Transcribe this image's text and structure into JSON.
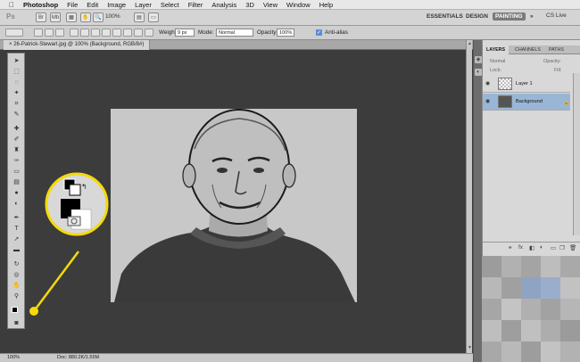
{
  "menubar": {
    "app": "Photoshop",
    "items": [
      "File",
      "Edit",
      "Image",
      "Layer",
      "Select",
      "Filter",
      "Analysis",
      "3D",
      "View",
      "Window",
      "Help"
    ]
  },
  "appbar": {
    "logo": "Ps",
    "zoom": "100%",
    "workspaces": [
      "ESSENTIALS",
      "DESIGN",
      "PAINTING"
    ],
    "active_workspace": "PAINTING",
    "more": "»",
    "cs_live": "CS Live"
  },
  "options": {
    "weight_label": "Weight:",
    "weight_value": "9 px",
    "mode_label": "Mode:",
    "mode_value": "Normal",
    "opacity_label": "Opacity:",
    "opacity_value": "100%",
    "antialias_label": "Anti-alias",
    "antialias_checked": true
  },
  "document": {
    "tab_title": "26-Patrick-Stewart.jpg @ 100% (Background, RGB/8#)",
    "close": "×"
  },
  "status": {
    "zoom": "100%",
    "doc": "Doc: 880.2K/1.55M"
  },
  "layers_panel": {
    "tabs": [
      "LAYERS",
      "CHANNELS",
      "PATHS"
    ],
    "active_tab": "LAYERS",
    "blend_mode": "Normal",
    "opacity_label": "Opacity:",
    "lock_label": "Lock:",
    "fill_label": "Fill:",
    "layers": [
      {
        "name": "Layer 1",
        "selected": false,
        "locked": false
      },
      {
        "name": "Background",
        "selected": true,
        "locked": true
      }
    ]
  },
  "icons": [
    "apple-icon",
    "brush-icon",
    "move-icon",
    "lasso-icon",
    "wand-icon",
    "crop-icon",
    "eyedropper-icon",
    "heal-icon",
    "brush-tool-icon",
    "stamp-icon",
    "history-brush-icon",
    "eraser-icon",
    "gradient-icon",
    "blur-icon",
    "dodge-icon",
    "pen-icon",
    "type-icon",
    "path-select-icon",
    "shape-icon",
    "3d-rotate-icon",
    "hand-icon",
    "zoom-icon",
    "quickmask-icon",
    "eye-icon",
    "lock-icon"
  ],
  "colors": {
    "callout": "#f5d90a",
    "canvas_bg": "#3c3c3c",
    "image_bg": "#c8c8c8",
    "layer_selected": "#9ab6d6"
  }
}
